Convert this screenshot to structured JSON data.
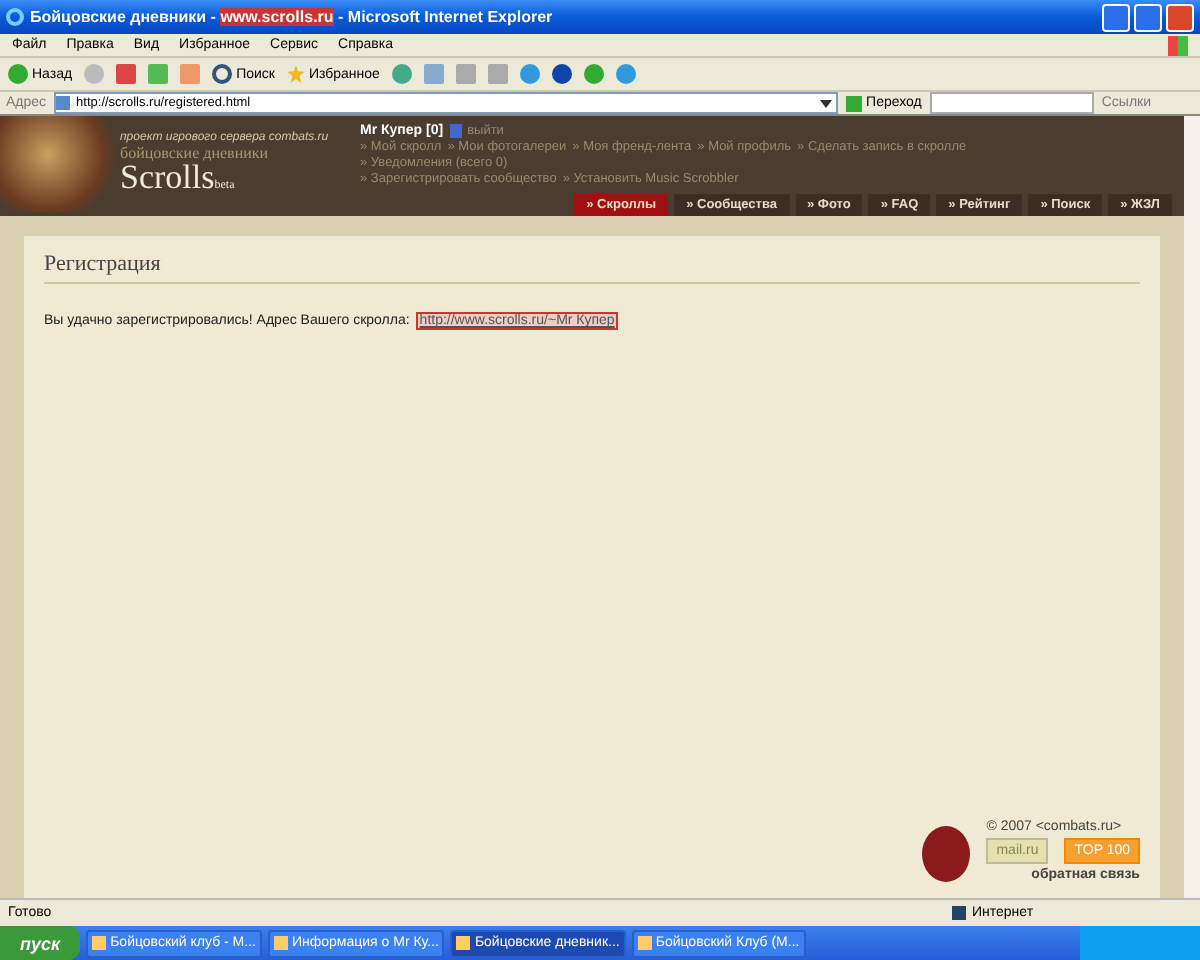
{
  "window": {
    "title_before": "Бойцовские дневники - ",
    "title_highlight": "www.scrolls.ru",
    "title_after": " - Microsoft Internet Explorer"
  },
  "menu": [
    "Файл",
    "Правка",
    "Вид",
    "Избранное",
    "Сервис",
    "Справка"
  ],
  "toolbar": {
    "back": "Назад",
    "search": "Поиск",
    "favorites": "Избранное"
  },
  "address_bar": {
    "label": "Адрес",
    "url": "http://scrolls.ru/registered.html",
    "go": "Переход",
    "links": "Ссылки"
  },
  "site_header": {
    "tagline": "проект игрового сервера combats.ru",
    "subtitle": "бойцовские дневники",
    "logo": "Scrolls",
    "logo_mark": "beta",
    "user": "Mr Купер [0]",
    "logout": "выйти",
    "link_lines": [
      [
        "» Мой скролл",
        "» Мои фотогалереи",
        "» Моя френд-лента",
        "» Мой профиль",
        "» Сделать запись в скролле"
      ],
      [
        "» Уведомления (всего 0)"
      ],
      [
        "» Зарегистрировать сообщество",
        "» Установить Music Scrobbler"
      ]
    ]
  },
  "tabs": [
    {
      "label": "» Скроллы",
      "selected": true
    },
    {
      "label": "» Сообщества",
      "selected": false
    },
    {
      "label": "» Фото",
      "selected": false
    },
    {
      "label": "» FAQ",
      "selected": false
    },
    {
      "label": "» Рейтинг",
      "selected": false
    },
    {
      "label": "» Поиск",
      "selected": false
    },
    {
      "label": "» ЖЗЛ",
      "selected": false
    }
  ],
  "content": {
    "heading": "Регистрация",
    "message": "Вы удачно зарегистрировались! Адрес Вашего скролла:",
    "link": "http://www.scrolls.ru/~Mr Купер"
  },
  "footer": {
    "copyright": "© 2007 <combats.ru>",
    "counter": "mail.ru",
    "top": "TOP 100",
    "feedback": "обратная связь"
  },
  "status_bar": {
    "text": "Готово",
    "zone": "Интернет"
  },
  "taskbar": {
    "start": "пуск",
    "tasks": [
      {
        "label": "Бойцовский клуб - М...",
        "selected": false
      },
      {
        "label": "Информация о Mr Ку...",
        "selected": false
      },
      {
        "label": "Бойцовские дневник...",
        "selected": true
      },
      {
        "label": "Бойцовский Клуб (М...",
        "selected": false
      }
    ]
  }
}
